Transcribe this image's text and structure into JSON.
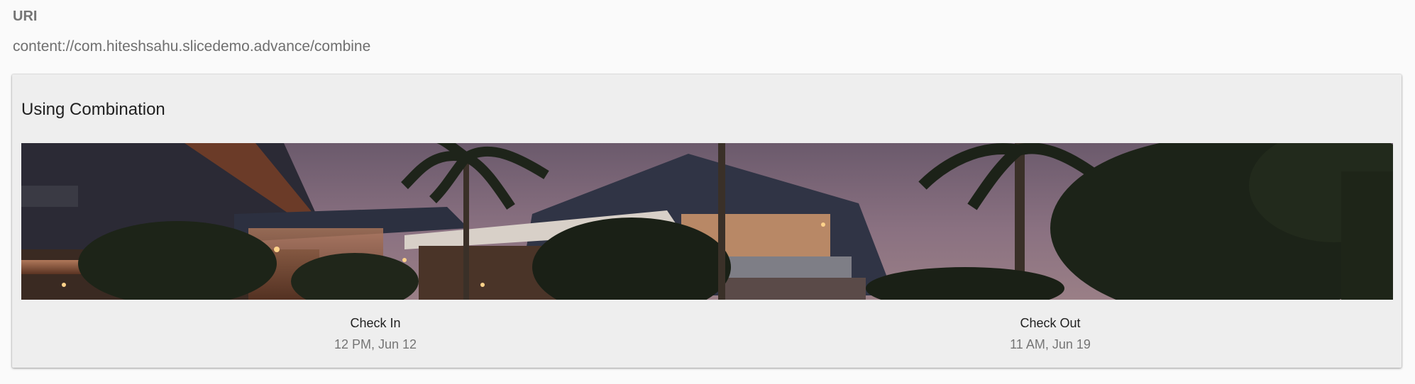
{
  "uri": {
    "label": "URI",
    "value": "content://com.hiteshsahu.slicedemo.advance/combine"
  },
  "slice": {
    "title": "Using Combination",
    "image_alt": "resort-at-dusk-image",
    "check_in": {
      "title": "Check In",
      "value": "12 PM, Jun 12"
    },
    "check_out": {
      "title": "Check Out",
      "value": "11 AM, Jun 19"
    }
  }
}
